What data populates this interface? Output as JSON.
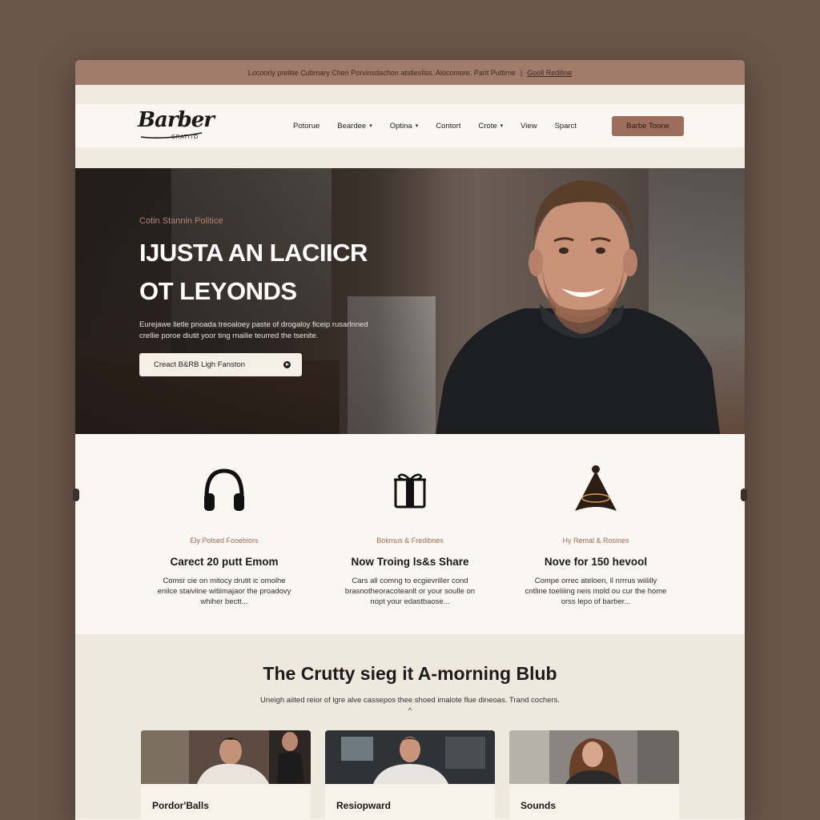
{
  "topbar": {
    "text": "Locoorly prelitie Cubmary Chen Porvinsdachon atstlesllss. Alocomore. Parit Puttirne",
    "separator": "|",
    "link": "Gooll Rediline"
  },
  "nav": {
    "logo_script": "Barber",
    "logo_sub": "CRATITO",
    "items": [
      {
        "label": "Potorue",
        "chevron": ""
      },
      {
        "label": "Beardee",
        "chevron": "▾"
      },
      {
        "label": "Optina",
        "chevron": "▾"
      },
      {
        "label": "Contort",
        "chevron": ""
      },
      {
        "label": "Crote",
        "chevron": "▾"
      },
      {
        "label": "View",
        "chevron": ""
      },
      {
        "label": "Sparct",
        "chevron": ""
      }
    ],
    "cta": "Barbe Toone"
  },
  "hero": {
    "eyebrow": "Cotin Stannin Politice",
    "title_line1": "IJUSTA AN LACIICR",
    "title_line2": "OT LEYONDS",
    "desc_line1": "Eurejawe lietle pnoada treoaloey paste of drogaloy ficeip rusarlnned",
    "desc_line2": "crellie poroe diutit yoor ting rnailie teurred the tsenite.",
    "button": "Creact B&RB Ligh Fanston"
  },
  "features": [
    {
      "icon": "headphones-icon",
      "eyebrow": "Ely Polsed Fooebiors",
      "title": "Carect 20 putt Emom",
      "desc": "Comsr cie on mitocy drutit ic omolhe enilce staiviine witiimajaor the proadovy whiher bectt..."
    },
    {
      "icon": "gift-icon",
      "eyebrow": "Bokmus & Fredibnes",
      "title": "Now Troing ls&s Share",
      "desc": "Cars all comng to ecgievriller cond brasnotheoracoteanlt or your soulle on nopt your edastbaose..."
    },
    {
      "icon": "cape-icon",
      "eyebrow": "Hy Remal & Rosines",
      "title": "Nove for 150 hevool",
      "desc": "Compe orrec ateloen, ll nrrrus wiililly cntline toeliiing neis mold ou cur the home orss lepo of barber..."
    }
  ],
  "blog": {
    "title": "The Crutty sieg it A-morning Blub",
    "subtitle": "Uneigh aiited reior of lgre alve cassepos thee shoed imalote flue dineoas. Trand cochers.",
    "chevron": "^",
    "cards": [
      {
        "title": "Pordor'Balls"
      },
      {
        "title": "Resiopward"
      },
      {
        "title": "Sounds"
      }
    ]
  },
  "colors": {
    "page_bg": "#6b5549",
    "topbar": "#a07b6b",
    "accent": "#9e6e5c",
    "cream": "#f5f1ea",
    "blog_bg": "#efe8dc"
  }
}
